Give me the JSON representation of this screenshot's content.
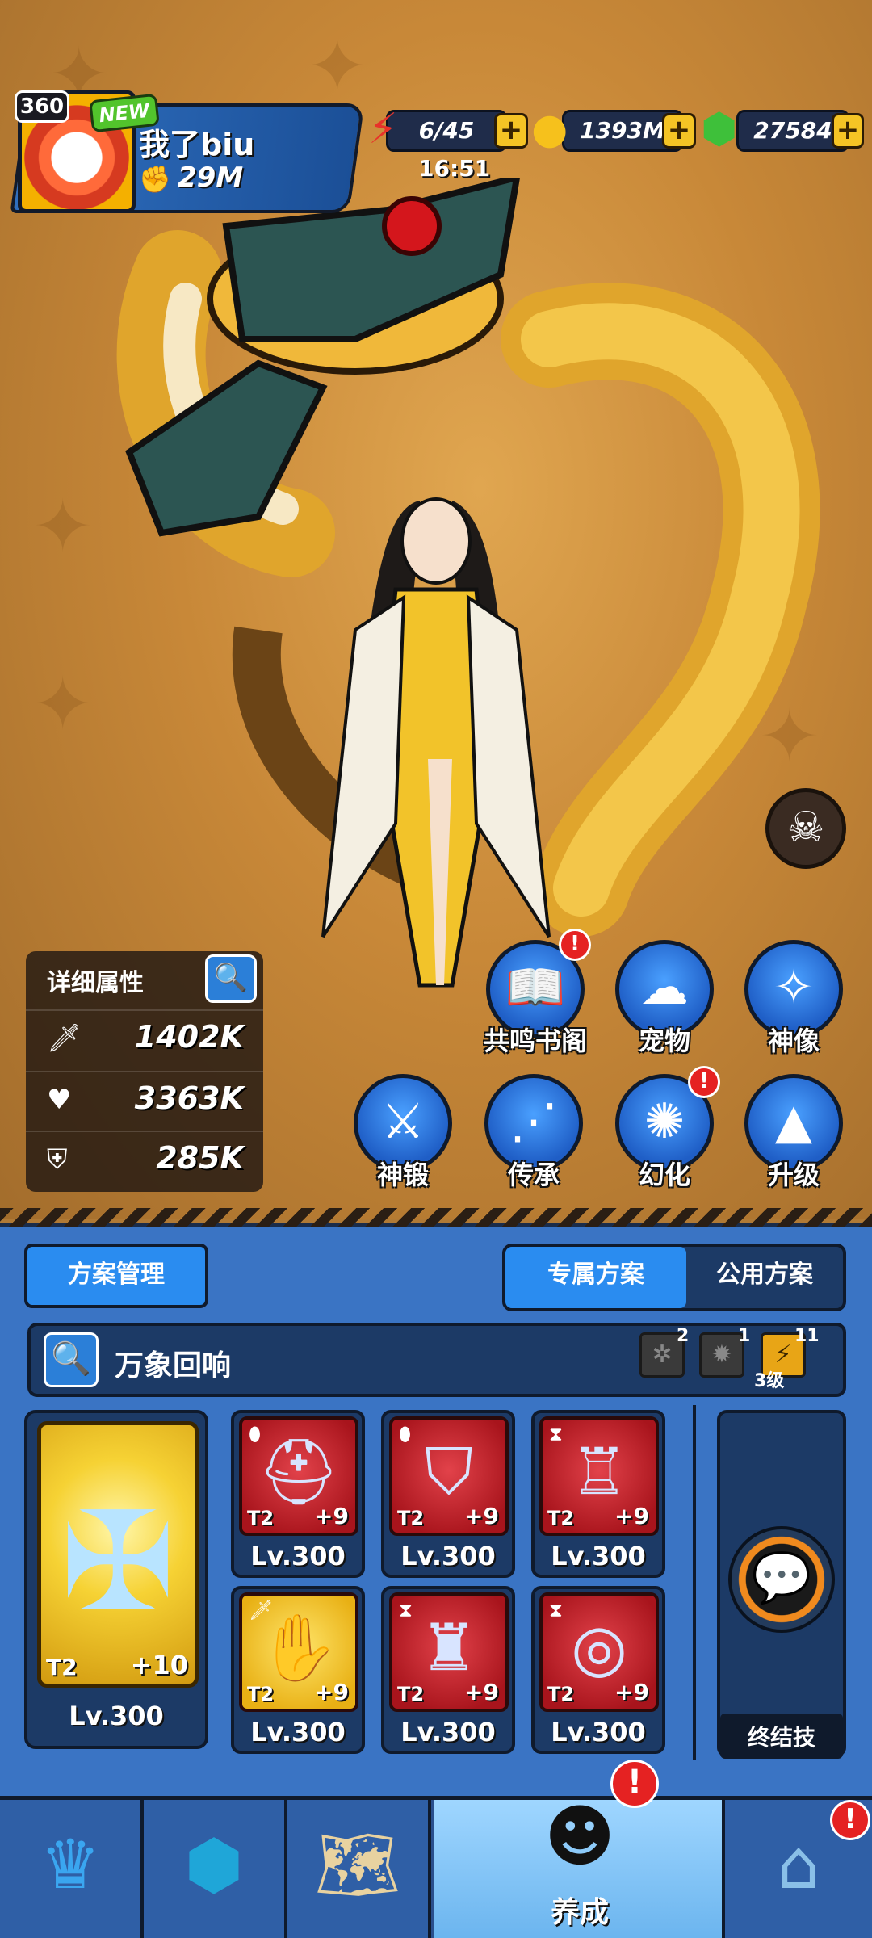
{
  "player": {
    "level": "360",
    "new_badge": "NEW",
    "name": "我了biu",
    "power": "29M"
  },
  "resources": {
    "energy": "6/45",
    "energy_timer": "16:51",
    "gold": "1393M",
    "gems": "27584",
    "plus": "+"
  },
  "stats": {
    "title": "详细属性",
    "attack": "1402K",
    "hp": "3363K",
    "defense": "285K"
  },
  "functions": {
    "row1": [
      {
        "label": "共鸣书阁",
        "icon": "book-icon",
        "alert": "!"
      },
      {
        "label": "宠物",
        "icon": "pet-icon"
      },
      {
        "label": "神像",
        "icon": "statue-icon"
      }
    ],
    "row2": [
      {
        "label": "神锻",
        "icon": "forge-icon"
      },
      {
        "label": "传承",
        "icon": "inherit-icon"
      },
      {
        "label": "幻化",
        "icon": "transform-icon",
        "alert": "!"
      },
      {
        "label": "升级",
        "icon": "levelup-icon"
      }
    ]
  },
  "tabs": {
    "manage": "方案管理",
    "exclusive": "专属方案",
    "public": "公用方案"
  },
  "scheme": {
    "name": "万象回响",
    "slot1_count": "2",
    "slot2_count": "1",
    "slot3_count": "11",
    "slot3_level": "3级"
  },
  "equipment": {
    "main": {
      "tier": "T2",
      "plus": "+10",
      "level": "Lv.300"
    },
    "items": [
      {
        "tier": "T2",
        "plus": "+9",
        "level": "Lv.300"
      },
      {
        "tier": "T2",
        "plus": "+9",
        "level": "Lv.300"
      },
      {
        "tier": "T2",
        "plus": "+9",
        "level": "Lv.300"
      },
      {
        "tier": "T2",
        "plus": "+9",
        "level": "Lv.300"
      },
      {
        "tier": "T2",
        "plus": "+9",
        "level": "Lv.300"
      },
      {
        "tier": "T2",
        "plus": "+9",
        "level": "Lv.300"
      }
    ]
  },
  "ultimate": {
    "label": "终结技"
  },
  "nav": {
    "active_label": "养成"
  },
  "colors": {
    "panel_blue": "#3a74c4",
    "accent_gold": "#f5c425",
    "alert_red": "#e52222"
  }
}
